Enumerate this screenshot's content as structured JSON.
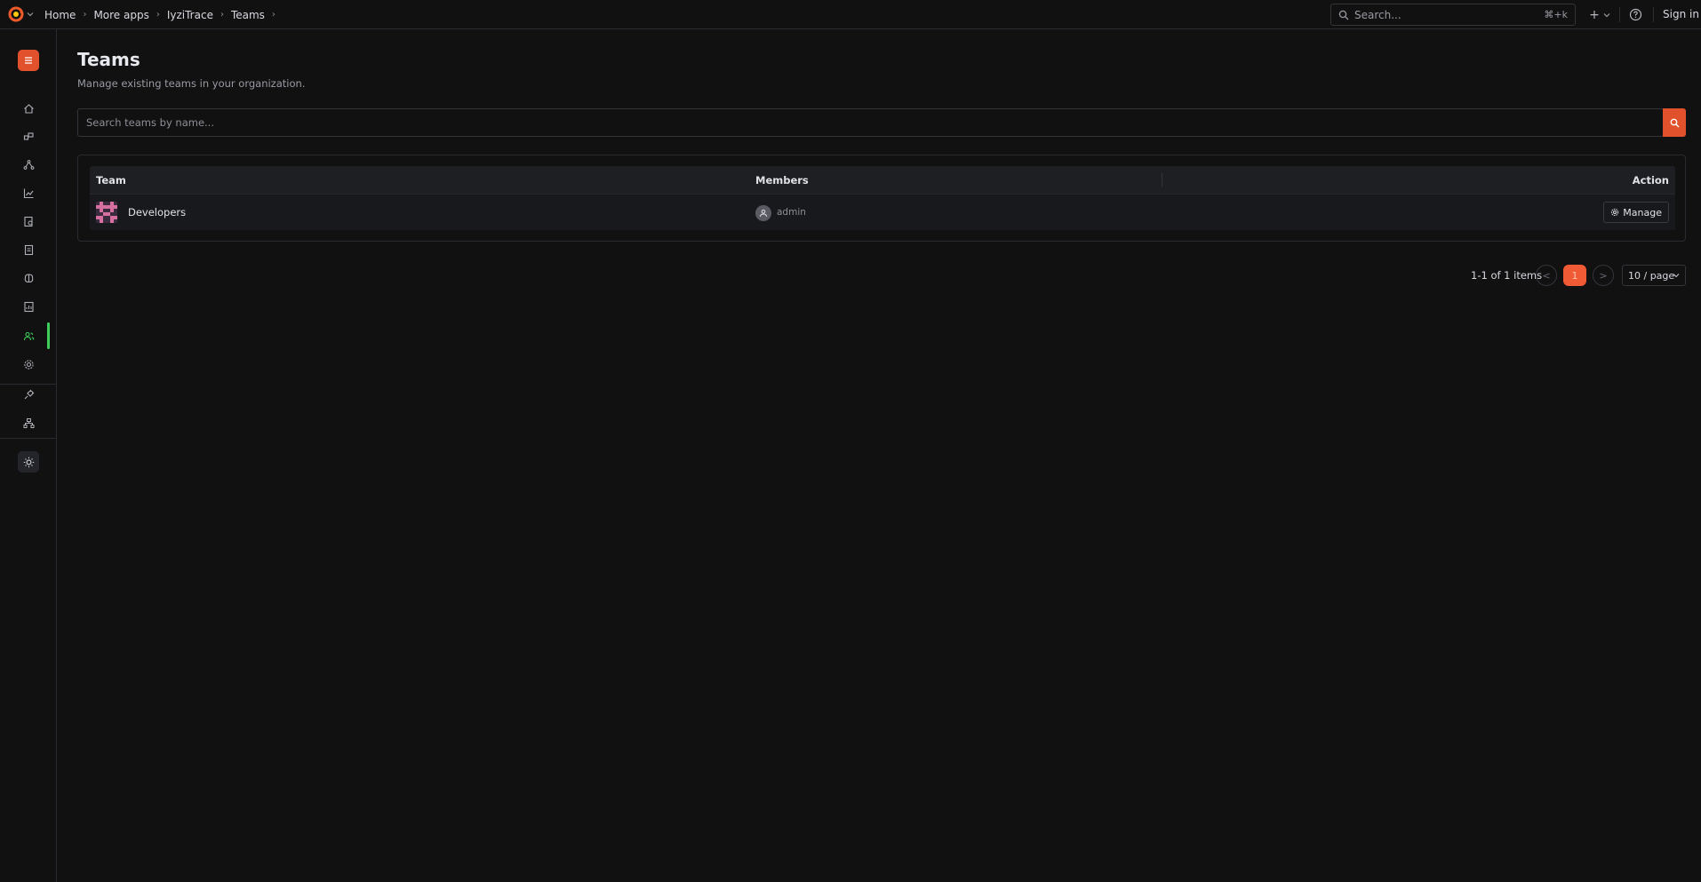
{
  "breadcrumb": {
    "items": [
      "Home",
      "More apps",
      "IyziTrace",
      "Teams"
    ]
  },
  "topbar": {
    "search_placeholder": "Search...",
    "search_shortcut": "⌘+k",
    "new_label": "+",
    "signin_label": "Sign in"
  },
  "sidebar": {
    "items": [
      {
        "name": "home",
        "icon": "home-icon"
      },
      {
        "name": "services",
        "icon": "cubes-icon"
      },
      {
        "name": "service-map",
        "icon": "graph-icon"
      },
      {
        "name": "metrics",
        "icon": "chart-icon"
      },
      {
        "name": "explore",
        "icon": "search-doc-icon"
      },
      {
        "name": "logs",
        "icon": "document-icon"
      },
      {
        "name": "ai",
        "icon": "brain-icon"
      },
      {
        "name": "reports",
        "icon": "report-icon"
      },
      {
        "name": "teams",
        "icon": "users-icon",
        "active": true
      },
      {
        "name": "settings",
        "icon": "gear-icon"
      },
      {
        "name": "integrations",
        "icon": "plug-icon"
      },
      {
        "name": "organization",
        "icon": "org-icon"
      }
    ],
    "accent_color": "#3ecf5b"
  },
  "page": {
    "title": "Teams",
    "subtitle": "Manage existing teams in your organization."
  },
  "team_search": {
    "placeholder": "Search teams by name..."
  },
  "table": {
    "columns": [
      "Team",
      "Members",
      "Action"
    ],
    "rows": [
      {
        "team": "Developers",
        "members": [
          "admin"
        ],
        "action": "Manage"
      }
    ]
  },
  "pagination": {
    "summary": "1-1 of 1 items",
    "current_page": "1",
    "prev_label": "<",
    "next_label": ">",
    "page_size": "10 / page"
  },
  "colors": {
    "brand": "#e0512c",
    "page_active": "#f05a35",
    "background": "#111112"
  }
}
